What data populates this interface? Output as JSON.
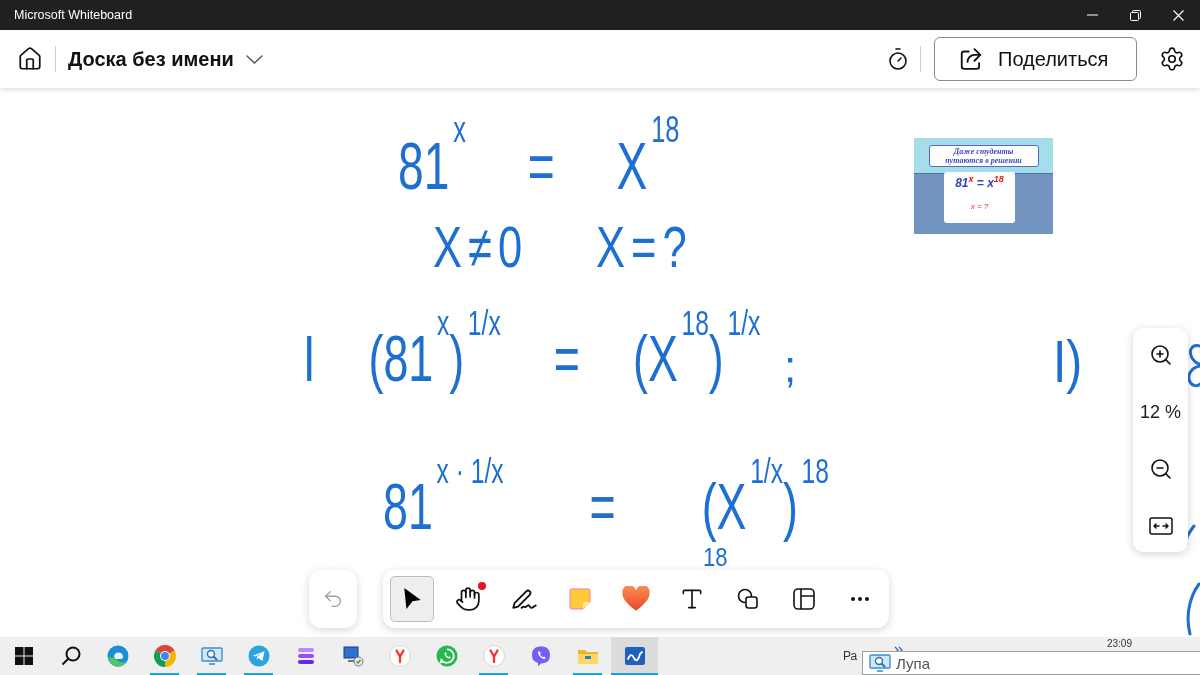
{
  "window": {
    "title": "Microsoft Whiteboard"
  },
  "header": {
    "board_title": "Доска без имени",
    "share_button": "Поделиться"
  },
  "canvas": {
    "ink": [
      "81$^{x}$ = X$^{18}$",
      "X≠0",
      "X=?",
      "I (81$^{x}$)$^{1/x}$ = (X$^{18}$)$^{1/x}$",
      ";",
      "81$^{x · 1/x}$ = (X$^{1/x}$)$^{18}$",
      "18",
      "I)"
    ],
    "inserted_image": {
      "heading": "Даже студенты путаются в решении",
      "equation": "81$^{x}$ = x$^{18}$",
      "question": "x = ?"
    }
  },
  "zoom_panel": {
    "level_text": "12 %"
  },
  "toolbar": {
    "undo": {
      "disabled": true
    },
    "tools": [
      {
        "kind": "select",
        "selected": true,
        "notification": false
      },
      {
        "kind": "hand",
        "selected": false,
        "notification": true
      },
      {
        "kind": "pen",
        "selected": false,
        "notification": false
      },
      {
        "kind": "sticky_note",
        "selected": false,
        "notification": false
      },
      {
        "kind": "reaction",
        "selected": false,
        "notification": false
      },
      {
        "kind": "text",
        "selected": false,
        "notification": false
      },
      {
        "kind": "shapes",
        "selected": false,
        "notification": false
      },
      {
        "kind": "template",
        "selected": false,
        "notification": false
      },
      {
        "kind": "more",
        "selected": false,
        "notification": false
      }
    ]
  },
  "taskbar": {
    "apps": [
      {
        "kind": "start",
        "running": false,
        "selected": false
      },
      {
        "kind": "search",
        "running": false,
        "selected": false
      },
      {
        "kind": "edge",
        "running": false,
        "selected": false
      },
      {
        "kind": "chrome",
        "running": true,
        "selected": false
      },
      {
        "kind": "magnifier",
        "running": true,
        "selected": false
      },
      {
        "kind": "telegram",
        "running": true,
        "selected": false
      },
      {
        "kind": "stack",
        "running": false,
        "selected": false
      },
      {
        "kind": "network",
        "running": false,
        "selected": false
      },
      {
        "kind": "yandex",
        "running": false,
        "selected": false
      },
      {
        "kind": "whatsapp",
        "running": false,
        "selected": false
      },
      {
        "kind": "yandex",
        "running": true,
        "selected": false
      },
      {
        "kind": "viber",
        "running": false,
        "selected": false
      },
      {
        "kind": "explorer",
        "running": true,
        "selected": false
      },
      {
        "kind": "whiteboard",
        "running": true,
        "selected": true
      }
    ],
    "tray_text": "Ра",
    "clock": "23:09",
    "tooltip": "Лупа"
  }
}
